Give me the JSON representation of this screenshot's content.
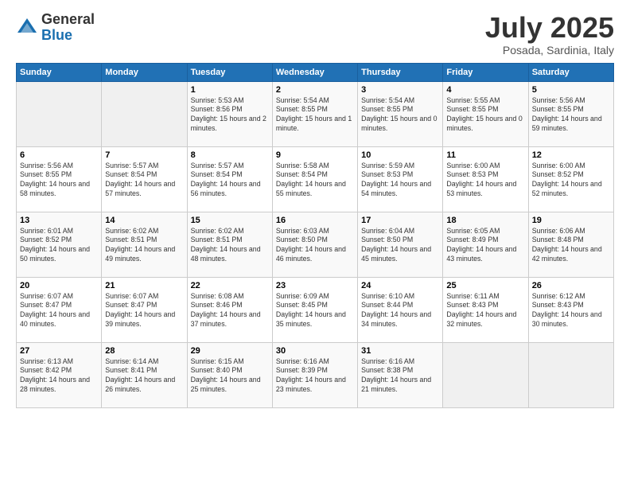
{
  "logo": {
    "general": "General",
    "blue": "Blue"
  },
  "title": "July 2025",
  "subtitle": "Posada, Sardinia, Italy",
  "days_header": [
    "Sunday",
    "Monday",
    "Tuesday",
    "Wednesday",
    "Thursday",
    "Friday",
    "Saturday"
  ],
  "weeks": [
    [
      {
        "day": "",
        "empty": true
      },
      {
        "day": "",
        "empty": true
      },
      {
        "day": "1",
        "sunrise": "Sunrise: 5:53 AM",
        "sunset": "Sunset: 8:56 PM",
        "daylight": "Daylight: 15 hours and 2 minutes."
      },
      {
        "day": "2",
        "sunrise": "Sunrise: 5:54 AM",
        "sunset": "Sunset: 8:55 PM",
        "daylight": "Daylight: 15 hours and 1 minute."
      },
      {
        "day": "3",
        "sunrise": "Sunrise: 5:54 AM",
        "sunset": "Sunset: 8:55 PM",
        "daylight": "Daylight: 15 hours and 0 minutes."
      },
      {
        "day": "4",
        "sunrise": "Sunrise: 5:55 AM",
        "sunset": "Sunset: 8:55 PM",
        "daylight": "Daylight: 15 hours and 0 minutes."
      },
      {
        "day": "5",
        "sunrise": "Sunrise: 5:56 AM",
        "sunset": "Sunset: 8:55 PM",
        "daylight": "Daylight: 14 hours and 59 minutes."
      }
    ],
    [
      {
        "day": "6",
        "sunrise": "Sunrise: 5:56 AM",
        "sunset": "Sunset: 8:55 PM",
        "daylight": "Daylight: 14 hours and 58 minutes."
      },
      {
        "day": "7",
        "sunrise": "Sunrise: 5:57 AM",
        "sunset": "Sunset: 8:54 PM",
        "daylight": "Daylight: 14 hours and 57 minutes."
      },
      {
        "day": "8",
        "sunrise": "Sunrise: 5:57 AM",
        "sunset": "Sunset: 8:54 PM",
        "daylight": "Daylight: 14 hours and 56 minutes."
      },
      {
        "day": "9",
        "sunrise": "Sunrise: 5:58 AM",
        "sunset": "Sunset: 8:54 PM",
        "daylight": "Daylight: 14 hours and 55 minutes."
      },
      {
        "day": "10",
        "sunrise": "Sunrise: 5:59 AM",
        "sunset": "Sunset: 8:53 PM",
        "daylight": "Daylight: 14 hours and 54 minutes."
      },
      {
        "day": "11",
        "sunrise": "Sunrise: 6:00 AM",
        "sunset": "Sunset: 8:53 PM",
        "daylight": "Daylight: 14 hours and 53 minutes."
      },
      {
        "day": "12",
        "sunrise": "Sunrise: 6:00 AM",
        "sunset": "Sunset: 8:52 PM",
        "daylight": "Daylight: 14 hours and 52 minutes."
      }
    ],
    [
      {
        "day": "13",
        "sunrise": "Sunrise: 6:01 AM",
        "sunset": "Sunset: 8:52 PM",
        "daylight": "Daylight: 14 hours and 50 minutes."
      },
      {
        "day": "14",
        "sunrise": "Sunrise: 6:02 AM",
        "sunset": "Sunset: 8:51 PM",
        "daylight": "Daylight: 14 hours and 49 minutes."
      },
      {
        "day": "15",
        "sunrise": "Sunrise: 6:02 AM",
        "sunset": "Sunset: 8:51 PM",
        "daylight": "Daylight: 14 hours and 48 minutes."
      },
      {
        "day": "16",
        "sunrise": "Sunrise: 6:03 AM",
        "sunset": "Sunset: 8:50 PM",
        "daylight": "Daylight: 14 hours and 46 minutes."
      },
      {
        "day": "17",
        "sunrise": "Sunrise: 6:04 AM",
        "sunset": "Sunset: 8:50 PM",
        "daylight": "Daylight: 14 hours and 45 minutes."
      },
      {
        "day": "18",
        "sunrise": "Sunrise: 6:05 AM",
        "sunset": "Sunset: 8:49 PM",
        "daylight": "Daylight: 14 hours and 43 minutes."
      },
      {
        "day": "19",
        "sunrise": "Sunrise: 6:06 AM",
        "sunset": "Sunset: 8:48 PM",
        "daylight": "Daylight: 14 hours and 42 minutes."
      }
    ],
    [
      {
        "day": "20",
        "sunrise": "Sunrise: 6:07 AM",
        "sunset": "Sunset: 8:47 PM",
        "daylight": "Daylight: 14 hours and 40 minutes."
      },
      {
        "day": "21",
        "sunrise": "Sunrise: 6:07 AM",
        "sunset": "Sunset: 8:47 PM",
        "daylight": "Daylight: 14 hours and 39 minutes."
      },
      {
        "day": "22",
        "sunrise": "Sunrise: 6:08 AM",
        "sunset": "Sunset: 8:46 PM",
        "daylight": "Daylight: 14 hours and 37 minutes."
      },
      {
        "day": "23",
        "sunrise": "Sunrise: 6:09 AM",
        "sunset": "Sunset: 8:45 PM",
        "daylight": "Daylight: 14 hours and 35 minutes."
      },
      {
        "day": "24",
        "sunrise": "Sunrise: 6:10 AM",
        "sunset": "Sunset: 8:44 PM",
        "daylight": "Daylight: 14 hours and 34 minutes."
      },
      {
        "day": "25",
        "sunrise": "Sunrise: 6:11 AM",
        "sunset": "Sunset: 8:43 PM",
        "daylight": "Daylight: 14 hours and 32 minutes."
      },
      {
        "day": "26",
        "sunrise": "Sunrise: 6:12 AM",
        "sunset": "Sunset: 8:43 PM",
        "daylight": "Daylight: 14 hours and 30 minutes."
      }
    ],
    [
      {
        "day": "27",
        "sunrise": "Sunrise: 6:13 AM",
        "sunset": "Sunset: 8:42 PM",
        "daylight": "Daylight: 14 hours and 28 minutes."
      },
      {
        "day": "28",
        "sunrise": "Sunrise: 6:14 AM",
        "sunset": "Sunset: 8:41 PM",
        "daylight": "Daylight: 14 hours and 26 minutes."
      },
      {
        "day": "29",
        "sunrise": "Sunrise: 6:15 AM",
        "sunset": "Sunset: 8:40 PM",
        "daylight": "Daylight: 14 hours and 25 minutes."
      },
      {
        "day": "30",
        "sunrise": "Sunrise: 6:16 AM",
        "sunset": "Sunset: 8:39 PM",
        "daylight": "Daylight: 14 hours and 23 minutes."
      },
      {
        "day": "31",
        "sunrise": "Sunrise: 6:16 AM",
        "sunset": "Sunset: 8:38 PM",
        "daylight": "Daylight: 14 hours and 21 minutes."
      },
      {
        "day": "",
        "empty": true
      },
      {
        "day": "",
        "empty": true
      }
    ]
  ]
}
